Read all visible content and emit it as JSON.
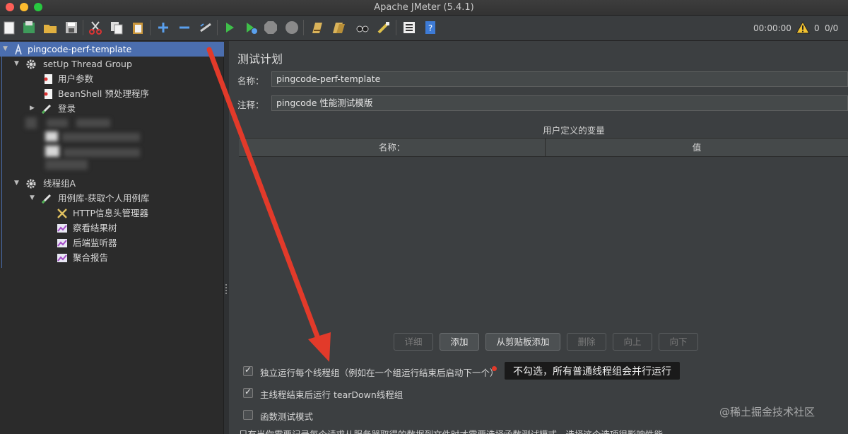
{
  "window": {
    "title": "Apache JMeter (5.4.1)"
  },
  "toolbar": {
    "timer": "00:00:00",
    "warning_count": "0",
    "thread_count": "0/0",
    "icons": [
      "new-icon",
      "templates-icon",
      "open-icon",
      "save-icon",
      "cut-icon",
      "copy-icon",
      "paste-icon",
      "expand-icon",
      "collapse-icon",
      "toggle-icon",
      "start-icon",
      "start-no-pause-icon",
      "stop-icon",
      "shutdown-icon",
      "clear-icon",
      "clear-all-icon",
      "search-icon",
      "reset-search-icon",
      "function-helper-icon",
      "help-icon"
    ]
  },
  "tree": {
    "items": [
      {
        "label": "pingcode-perf-template",
        "icon": "test-plan-icon",
        "selected": true
      },
      {
        "label": "setUp Thread Group",
        "icon": "gear-icon"
      },
      {
        "label": "用户参数",
        "icon": "preprocessor-icon"
      },
      {
        "label": "BeanShell 预处理程序",
        "icon": "preprocessor-icon"
      },
      {
        "label": "登录",
        "icon": "controller-icon"
      },
      {
        "label": "线程组A",
        "icon": "gear-icon"
      },
      {
        "label": "用例库-获取个人用例库",
        "icon": "controller-icon"
      },
      {
        "label": "HTTP信息头管理器",
        "icon": "tools-icon"
      },
      {
        "label": "察看结果树",
        "icon": "listener-icon"
      },
      {
        "label": "后端监听器",
        "icon": "listener-icon"
      },
      {
        "label": "聚合报告",
        "icon": "listener-icon"
      }
    ]
  },
  "panel": {
    "title": "测试计划",
    "name_label": "名称：",
    "name_value": "pingcode-perf-template",
    "comment_label": "注释：",
    "comment_value": "pingcode 性能测试模版",
    "udv_title": "用户定义的变量",
    "udv_col_name": "名称：",
    "udv_col_value": "值",
    "buttons": {
      "detail": "详细",
      "add": "添加",
      "add_clipboard": "从剪贴板添加",
      "delete": "删除",
      "up": "向上",
      "down": "向下"
    },
    "checks": {
      "serialize": {
        "label": "独立运行每个线程组（例如在一个组运行结束后启动下一个）",
        "checked": true
      },
      "teardown": {
        "label": "主线程结束后运行 tearDown线程组",
        "checked": true
      },
      "functional": {
        "label": "函数测试模式",
        "checked": false
      }
    },
    "cut_text": "只有当你需要记录每个请求从服务器取得的数据到文件时才需要选择函数测试模式。选择这个选项很影响性能。"
  },
  "annotation": {
    "tooltip": "不勾选，所有普通线程组会并行运行",
    "arrow_color": "#e23a2a"
  },
  "watermark": "@稀土掘金技术社区"
}
